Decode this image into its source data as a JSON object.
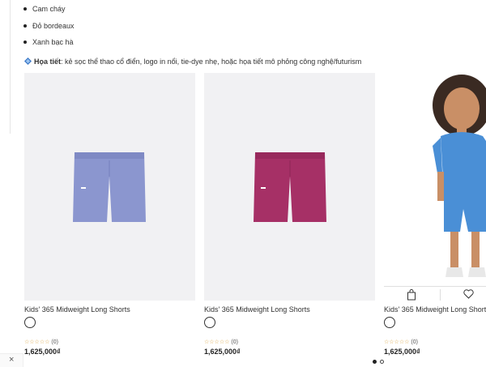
{
  "colors_list": [
    "Cam cháy",
    "Đỏ bordeaux",
    "Xanh bạc hà"
  ],
  "pattern": {
    "label": "Họa tiết",
    "text": ": kẻ sọc thể thao cổ điển, logo in nổi, tie-dye nhẹ, hoặc họa tiết mô phỏng công nghệ/futurism",
    "icon": "blue-diamond-icon"
  },
  "products": [
    {
      "title": "Kids' 365 Midweight Long Shorts",
      "reviews": "(0)",
      "price": "1,625,000₫",
      "color": "#8b96cf"
    },
    {
      "title": "Kids' 365 Midweight Long Shorts",
      "reviews": "(0)",
      "price": "1,625,000₫",
      "color": "#a63066"
    },
    {
      "title": "Kids' 365 Midweight Long Shorts",
      "reviews": "(0)",
      "price": "1,625,000₫",
      "color": "#4a8fd6"
    }
  ],
  "stars": "☆☆☆☆☆",
  "close_symbol": "×",
  "carousel": {
    "pages": 2,
    "current": 1
  },
  "accent": {
    "star": "#d9a441",
    "placeholder_bg": "#f1f1f3"
  }
}
